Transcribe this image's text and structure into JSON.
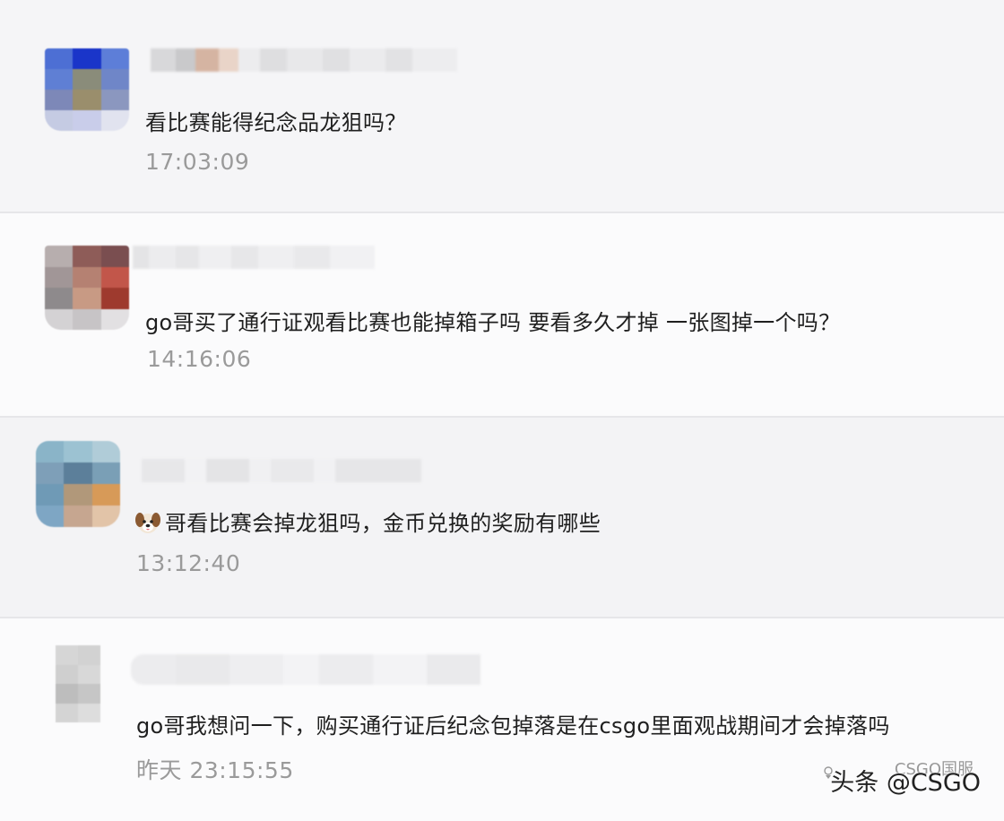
{
  "comments": [
    {
      "message": "看比赛能得纪念品龙狙吗？",
      "time": "17:03:09"
    },
    {
      "message": "go哥买了通行证观看比赛也能掉箱子吗 要看多久才掉 一张图掉一个吗？",
      "time": "14:16:06"
    },
    {
      "message": "哥看比赛会掉龙狙吗，金币兑换的奖励有哪些",
      "time": "13:12:40",
      "emoji": "dog-face-icon"
    },
    {
      "message": "go哥我想问一下，购买通行证后纪念包掉落是在csgo里面观战期间才会掉落吗",
      "time": "昨天 23:15:55"
    }
  ],
  "watermark": {
    "text": "头条 @CSGO",
    "ghost_text": "CSGO国服"
  },
  "colors": {
    "message_text": "#1f1f1f",
    "timestamp_text": "#9a9a9a",
    "divider": "#e6e6e9"
  }
}
